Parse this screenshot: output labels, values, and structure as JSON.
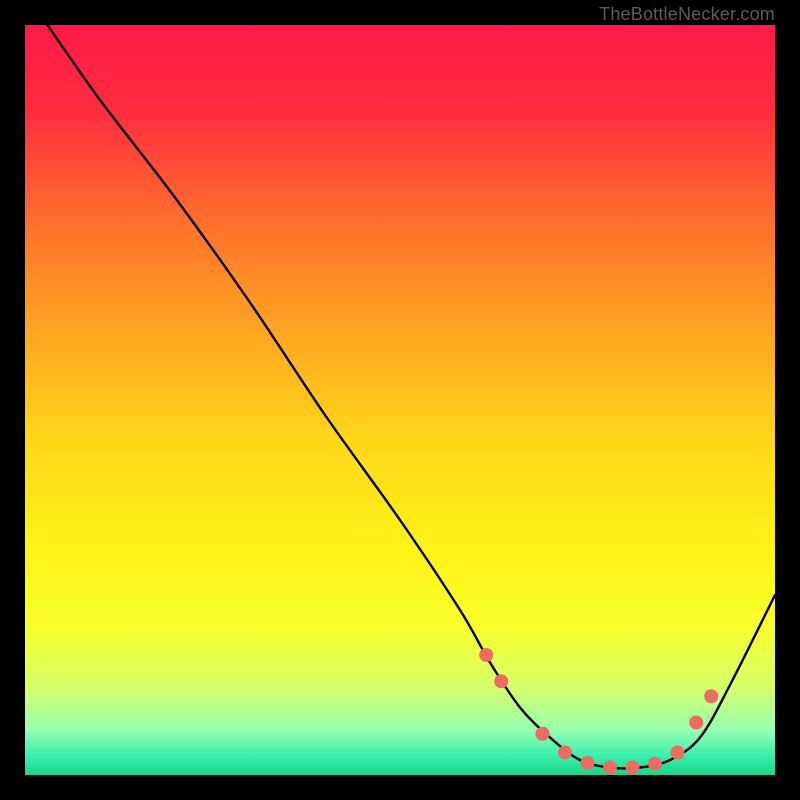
{
  "watermark": "TheBottleNecker.com",
  "chart_data": {
    "type": "line",
    "title": "",
    "xlabel": "",
    "ylabel": "",
    "xlim": [
      0,
      100
    ],
    "ylim": [
      0,
      100
    ],
    "gradient_stops": [
      {
        "pos": 0.0,
        "color": "#ff1948"
      },
      {
        "pos": 0.12,
        "color": "#ff2e3f"
      },
      {
        "pos": 0.25,
        "color": "#ff6a2e"
      },
      {
        "pos": 0.4,
        "color": "#ffa222"
      },
      {
        "pos": 0.55,
        "color": "#ffd61a"
      },
      {
        "pos": 0.7,
        "color": "#fff317"
      },
      {
        "pos": 0.8,
        "color": "#f8ff2b"
      },
      {
        "pos": 0.88,
        "color": "#d7ff66"
      },
      {
        "pos": 0.94,
        "color": "#96ffb0"
      },
      {
        "pos": 0.975,
        "color": "#37efae"
      },
      {
        "pos": 1.0,
        "color": "#17d688"
      }
    ],
    "series": [
      {
        "name": "bottleneck-curve",
        "x": [
          3,
          10,
          20,
          30,
          40,
          50,
          58,
          62,
          66,
          70,
          74,
          78,
          82,
          86,
          90,
          94,
          100
        ],
        "y": [
          100,
          90,
          77,
          63,
          48,
          34,
          22,
          15,
          9,
          5,
          2,
          1,
          1,
          2,
          5,
          12,
          24
        ]
      }
    ],
    "markers": {
      "x": [
        61.5,
        63.5,
        69,
        72,
        75,
        78,
        81,
        84,
        87,
        89.5,
        91.5
      ],
      "y": [
        16,
        12.5,
        5.5,
        3,
        1.6,
        1,
        1,
        1.5,
        3,
        7,
        10.5
      ],
      "color": "#ef6a62",
      "radius": 7
    }
  }
}
